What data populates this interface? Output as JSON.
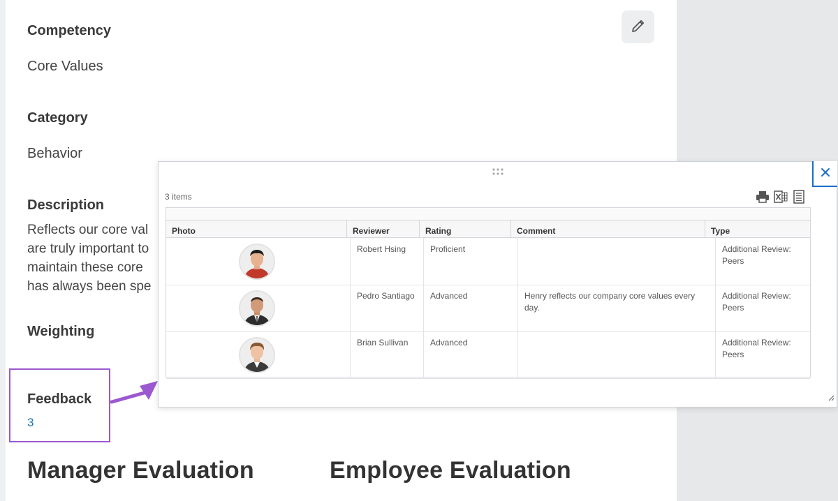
{
  "fields": {
    "competency_label": "Competency",
    "competency_value": "Core Values",
    "category_label": "Category",
    "category_value": "Behavior",
    "description_label": "Description",
    "description_lines": [
      "Reflects our core val",
      "are truly important to",
      "maintain these core",
      "has always been spe"
    ],
    "weighting_label": "Weighting",
    "feedback_label": "Feedback",
    "feedback_count": "3"
  },
  "sections": {
    "manager": "Manager Evaluation",
    "employee": "Employee Evaluation"
  },
  "icons": {
    "edit": "pencil-icon",
    "close": "close-icon",
    "drag": "drag-handle-icon",
    "print": "print-icon",
    "excel": "export-excel-icon",
    "columns": "column-settings-icon",
    "resize": "resize-grip-icon"
  },
  "popup": {
    "items_count": "3 items",
    "columns": [
      "Photo",
      "Reviewer",
      "Rating",
      "Comment",
      "Type"
    ],
    "rows": [
      {
        "reviewer": "Robert Hsing",
        "rating": "Proficient",
        "comment": "",
        "type": "Additional Review: Peers"
      },
      {
        "reviewer": "Pedro Santiago",
        "rating": "Advanced",
        "comment": "Henry reflects our company core values every day.",
        "type": "Additional Review: Peers"
      },
      {
        "reviewer": "Brian Sullivan",
        "rating": "Advanced",
        "comment": "",
        "type": "Additional Review: Peers"
      }
    ]
  },
  "colors": {
    "highlight_border": "#9b59d0",
    "link": "#1a73b8",
    "close_border": "#1a6fc9"
  }
}
